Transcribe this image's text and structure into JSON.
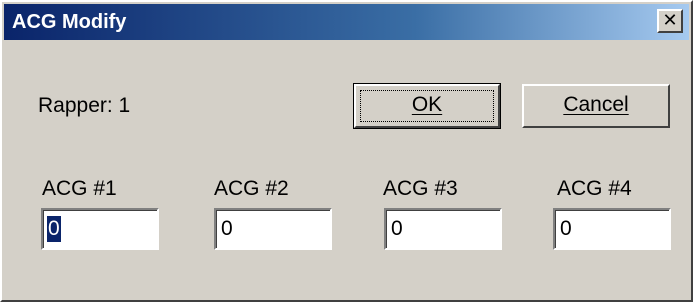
{
  "window": {
    "title": "ACG Modify",
    "close_glyph": "✕"
  },
  "rapper_label": "Rapper: 1",
  "buttons": {
    "ok": "OK",
    "cancel": "Cancel"
  },
  "fields": [
    {
      "label": "ACG #1",
      "value": "0",
      "selected": true
    },
    {
      "label": "ACG #2",
      "value": "0",
      "selected": false
    },
    {
      "label": "ACG #3",
      "value": "0",
      "selected": false
    },
    {
      "label": "ACG #4",
      "value": "0",
      "selected": false
    }
  ]
}
